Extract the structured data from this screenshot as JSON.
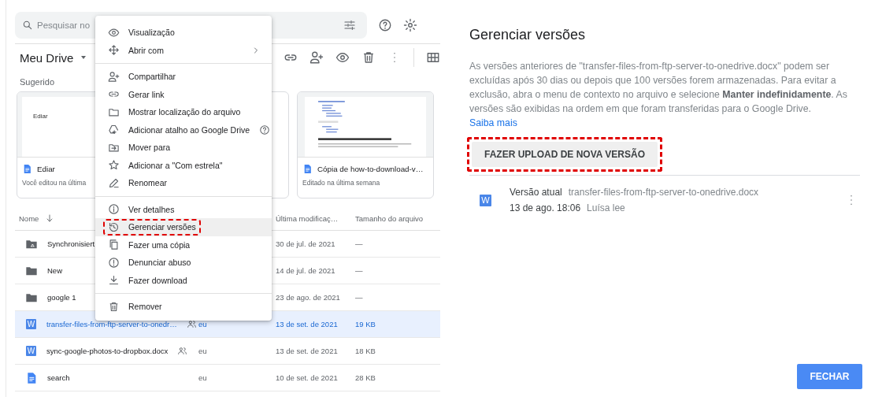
{
  "drive": {
    "search": {
      "placeholder": "Pesquisar no"
    },
    "title": "Meu Drive",
    "section": "Sugerido",
    "cards": [
      {
        "kind": "blank",
        "thumb_text": "Ediar",
        "name": "Ediar",
        "subtitle": "Você editou na última"
      },
      {
        "kind": "hidden"
      },
      {
        "kind": "webpage",
        "name": "Cópia de how-to-download-v…",
        "subtitle": "Editado na última semana"
      }
    ],
    "columns": [
      {
        "label": "Nome",
        "sorted": true
      },
      {
        "label": "Última modificaç…",
        "sorted": false
      },
      {
        "label": "Tamanho do arquivo",
        "sorted": false
      }
    ],
    "rows": [
      {
        "kind": "shared-folder",
        "name": "Synchronisiert",
        "owner": "",
        "modified": "30 de jul. de 2021",
        "size": "—",
        "selected": false
      },
      {
        "kind": "folder",
        "name": "New",
        "owner": "",
        "modified": "14 de jul. de 2021",
        "size": "—",
        "selected": false
      },
      {
        "kind": "folder",
        "name": "google 1",
        "owner": "",
        "modified": "23 de ago. de 2021",
        "size": "—",
        "selected": false
      },
      {
        "kind": "word",
        "badge": "W",
        "name": "transfer-files-from-ftp-server-to-onedr…",
        "shared": true,
        "owner": "eu",
        "modified": "13 de set. de 2021",
        "size": "19 KB",
        "selected": true
      },
      {
        "kind": "word",
        "badge": "W",
        "name": "sync-google-photos-to-dropbox.docx",
        "shared": true,
        "owner": "eu",
        "modified": "13 de set. de 2021",
        "size": "18 KB",
        "selected": false
      },
      {
        "kind": "doc",
        "name": "search",
        "shared": false,
        "owner": "eu",
        "modified": "10 de set. de 2021",
        "size": "28 KB",
        "selected": false
      }
    ]
  },
  "context_menu": {
    "groups": [
      [
        {
          "label": "Visualização",
          "submenu": false,
          "help": false,
          "selected": false,
          "highlighted": false
        },
        {
          "label": "Abrir com",
          "submenu": true,
          "help": false,
          "selected": false,
          "highlighted": false
        }
      ],
      [
        {
          "label": "Compartilhar",
          "submenu": false,
          "help": false,
          "selected": false,
          "highlighted": false
        },
        {
          "label": "Gerar link",
          "submenu": false,
          "help": false,
          "selected": false,
          "highlighted": false
        },
        {
          "label": "Mostrar localização do arquivo",
          "submenu": false,
          "help": false,
          "selected": false,
          "highlighted": false
        },
        {
          "label": "Adicionar atalho ao Google Drive",
          "submenu": false,
          "help": true,
          "selected": false,
          "highlighted": false
        },
        {
          "label": "Mover para",
          "submenu": false,
          "help": false,
          "selected": false,
          "highlighted": false
        },
        {
          "label": "Adicionar a \"Com estrela\"",
          "submenu": false,
          "help": false,
          "selected": false,
          "highlighted": false
        },
        {
          "label": "Renomear",
          "submenu": false,
          "help": false,
          "selected": false,
          "highlighted": false
        }
      ],
      [
        {
          "label": "Ver detalhes",
          "submenu": false,
          "help": false,
          "selected": false,
          "highlighted": false
        },
        {
          "label": "Gerenciar versões",
          "submenu": false,
          "help": false,
          "selected": true,
          "highlighted": true
        },
        {
          "label": "Fazer uma cópia",
          "submenu": false,
          "help": false,
          "selected": false,
          "highlighted": false
        },
        {
          "label": "Denunciar abuso",
          "submenu": false,
          "help": false,
          "selected": false,
          "highlighted": false
        },
        {
          "label": "Fazer download",
          "submenu": false,
          "help": false,
          "selected": false,
          "highlighted": false
        }
      ],
      [
        {
          "label": "Remover",
          "submenu": false,
          "help": false,
          "selected": false,
          "highlighted": false
        }
      ]
    ]
  },
  "dialog": {
    "title": "Gerenciar versões",
    "description": "As versões anteriores de \"transfer-files-from-ftp-server-to-onedrive.docx\" podem ser excluídas após 30 dias ou depois que 100 versões forem armazenadas. Para evitar a exclusão, abra o menu de contexto no arquivo e selecione **Manter indefinidamente**. As versões são exibidas na ordem em que foram transferidas para o Google Drive.",
    "link": "Saiba mais",
    "upload_button": {
      "label": "FAZER UPLOAD DE NOVA VERSÃO",
      "highlighted": true
    },
    "versions": [
      {
        "badge": "W",
        "label": "Versão atual",
        "file": "transfer-files-from-ftp-server-to-onedrive.docx",
        "date": "13 de ago. 18:06",
        "author": "Luísa lee"
      }
    ],
    "close_button": "FECHAR"
  }
}
